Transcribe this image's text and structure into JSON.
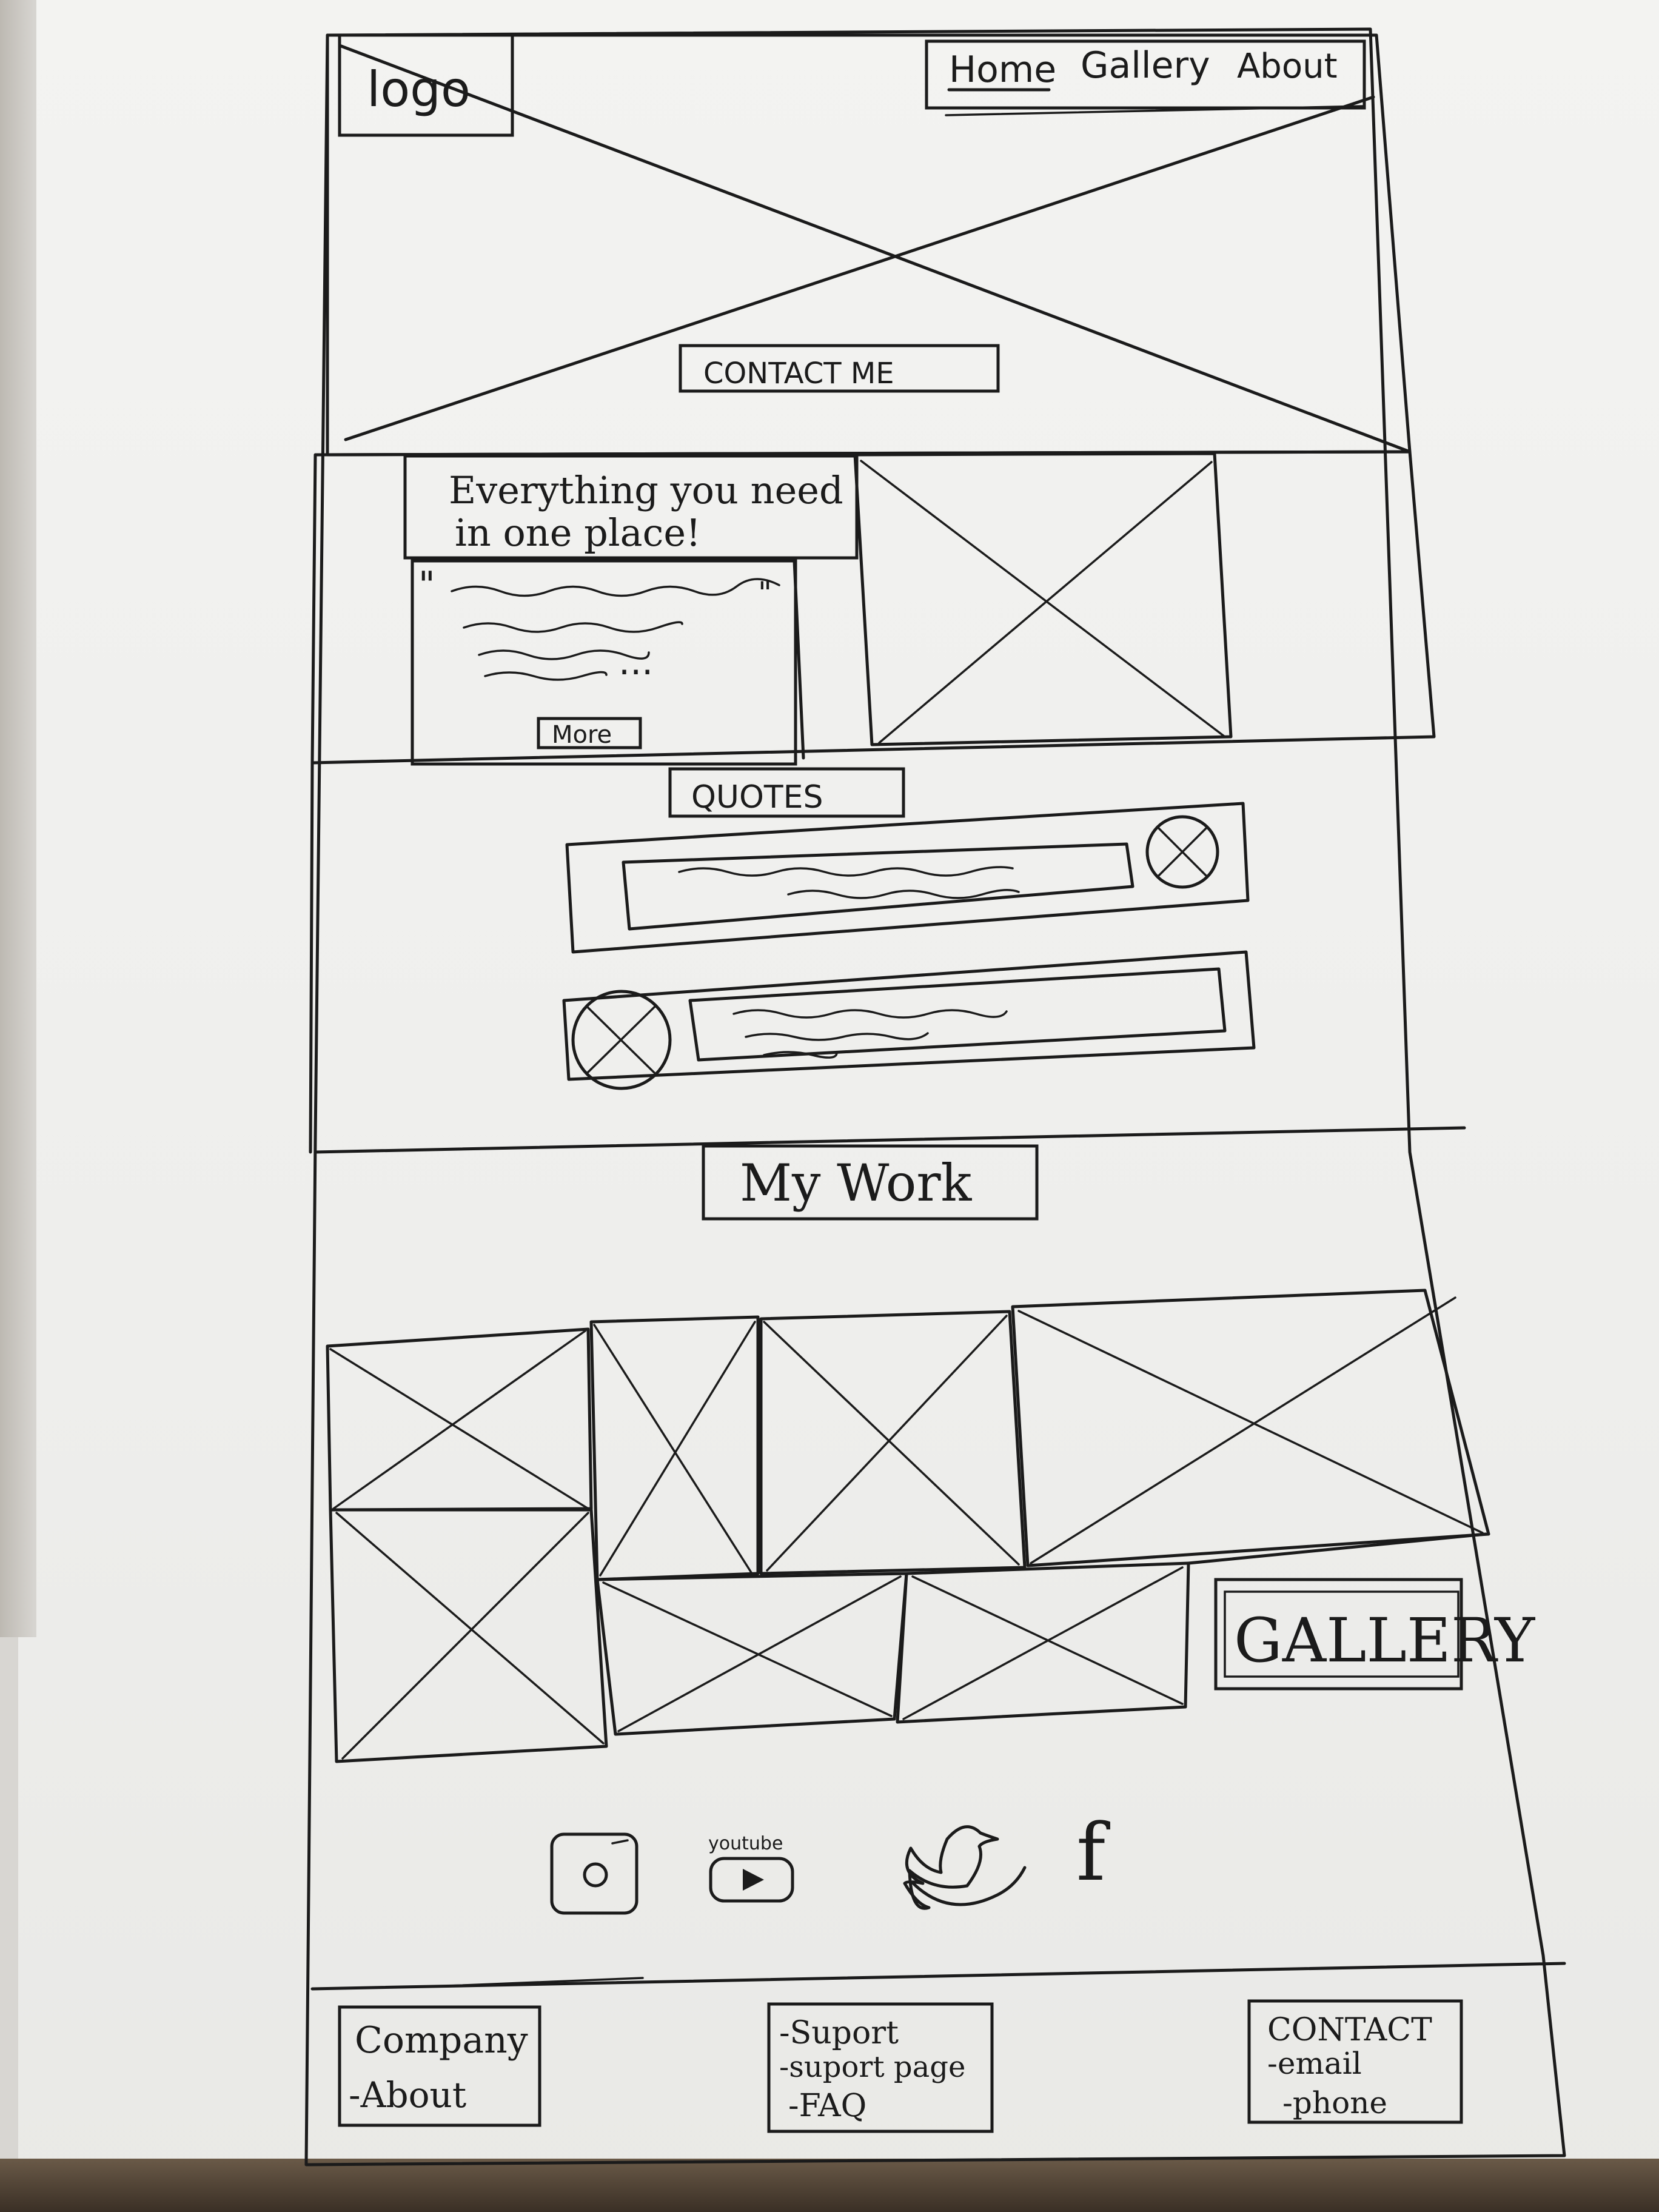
{
  "header": {
    "logo": "logo",
    "nav": [
      {
        "label": "Home"
      },
      {
        "label": "Gallery"
      },
      {
        "label": "About"
      }
    ],
    "cta": "CONTACT ME"
  },
  "intro": {
    "headline_line1": "Everything you need",
    "headline_line2": "in one place!",
    "quote_open": "\"",
    "quote_close": "\"",
    "ellipsis": "...",
    "more_button": "More"
  },
  "quotes": {
    "title": "QUOTES"
  },
  "work": {
    "title": "My Work",
    "gallery_button": "GALLERY"
  },
  "social": {
    "icons": [
      "instagram-icon",
      "youtube-icon",
      "twitter-icon",
      "facebook-icon"
    ],
    "youtube_label": "youtube",
    "facebook_glyph": "f"
  },
  "footer": {
    "columns": [
      {
        "title": "Company",
        "items": [
          "-About"
        ]
      },
      {
        "title": "-Suport",
        "items": [
          "-suport page",
          "-FAQ"
        ]
      },
      {
        "title": "CONTACT",
        "items": [
          "-email",
          "-phone"
        ]
      }
    ]
  }
}
